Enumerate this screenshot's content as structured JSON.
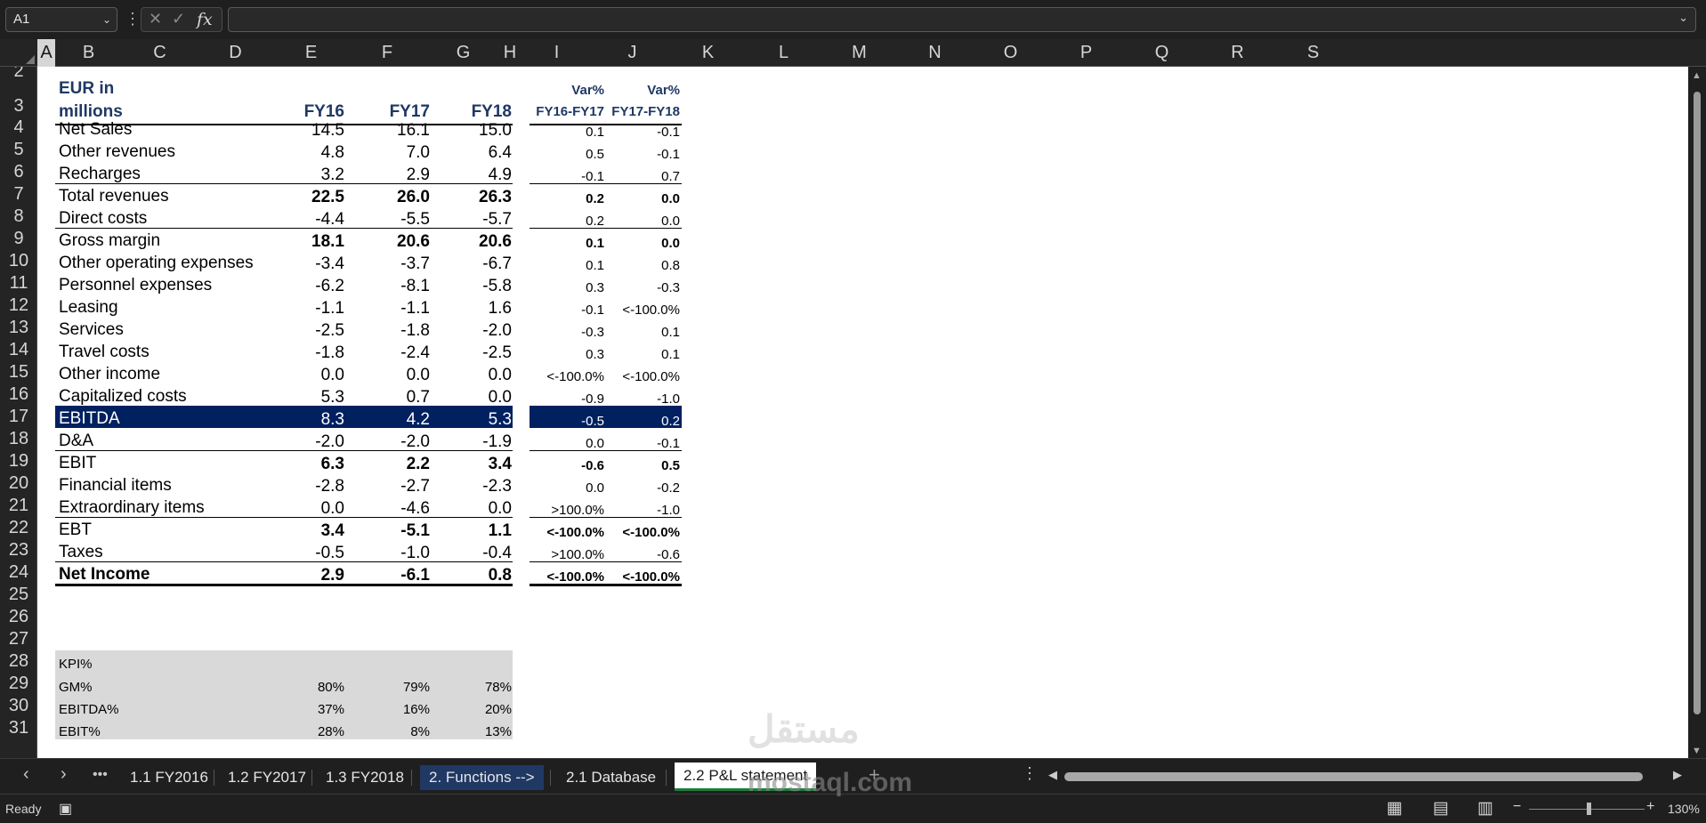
{
  "formula_bar": {
    "name_box": "A1",
    "formula": ""
  },
  "columns": [
    "A",
    "B",
    "C",
    "D",
    "E",
    "F",
    "G",
    "H",
    "I",
    "J",
    "K",
    "L",
    "M",
    "N",
    "O",
    "P",
    "Q",
    "R",
    "S"
  ],
  "rows": [
    "2",
    "3",
    "4",
    "5",
    "6",
    "7",
    "8",
    "9",
    "10",
    "11",
    "12",
    "13",
    "14",
    "15",
    "16",
    "17",
    "18",
    "19",
    "20",
    "21",
    "22",
    "23",
    "24",
    "25",
    "26",
    "27",
    "28",
    "29",
    "30",
    "31"
  ],
  "header": {
    "label_line1": "EUR in",
    "label_line2": "millions",
    "fy16": "FY16",
    "fy17": "FY17",
    "fy18": "FY18",
    "var1_line1": "Var%",
    "var1_line2": "FY16-FY17",
    "var2_line1": "Var%",
    "var2_line2": "FY17-FY18"
  },
  "pl": [
    {
      "label": "Net Sales",
      "fy16": "14.5",
      "fy17": "16.1",
      "fy18": "15.0",
      "var1": "0.1",
      "var2": "-0.1"
    },
    {
      "label": "Other revenues",
      "fy16": "4.8",
      "fy17": "7.0",
      "fy18": "6.4",
      "var1": "0.5",
      "var2": "-0.1"
    },
    {
      "label": "Recharges",
      "fy16": "3.2",
      "fy17": "2.9",
      "fy18": "4.9",
      "var1": "-0.1",
      "var2": "0.7"
    },
    {
      "label": "Total revenues",
      "fy16": "22.5",
      "fy17": "26.0",
      "fy18": "26.3",
      "var1": "0.2",
      "var2": "0.0"
    },
    {
      "label": "Direct costs",
      "fy16": "-4.4",
      "fy17": "-5.5",
      "fy18": "-5.7",
      "var1": "0.2",
      "var2": "0.0"
    },
    {
      "label": "Gross margin",
      "fy16": "18.1",
      "fy17": "20.6",
      "fy18": "20.6",
      "var1": "0.1",
      "var2": "0.0"
    },
    {
      "label": "Other operating expenses",
      "fy16": "-3.4",
      "fy17": "-3.7",
      "fy18": "-6.7",
      "var1": "0.1",
      "var2": "0.8"
    },
    {
      "label": "Personnel expenses",
      "fy16": "-6.2",
      "fy17": "-8.1",
      "fy18": "-5.8",
      "var1": "0.3",
      "var2": "-0.3"
    },
    {
      "label": "Leasing",
      "fy16": "-1.1",
      "fy17": "-1.1",
      "fy18": "1.6",
      "var1": "-0.1",
      "var2": "<-100.0%"
    },
    {
      "label": "Services",
      "fy16": "-2.5",
      "fy17": "-1.8",
      "fy18": "-2.0",
      "var1": "-0.3",
      "var2": "0.1"
    },
    {
      "label": "Travel costs",
      "fy16": "-1.8",
      "fy17": "-2.4",
      "fy18": "-2.5",
      "var1": "0.3",
      "var2": "0.1"
    },
    {
      "label": "Other income",
      "fy16": "0.0",
      "fy17": "0.0",
      "fy18": "0.0",
      "var1": "<-100.0%",
      "var2": "<-100.0%"
    },
    {
      "label": "Capitalized costs",
      "fy16": "5.3",
      "fy17": "0.7",
      "fy18": "0.0",
      "var1": "-0.9",
      "var2": "-1.0"
    },
    {
      "label": "EBITDA",
      "fy16": "8.3",
      "fy17": "4.2",
      "fy18": "5.3",
      "var1": "-0.5",
      "var2": "0.2"
    },
    {
      "label": "D&A",
      "fy16": "-2.0",
      "fy17": "-2.0",
      "fy18": "-1.9",
      "var1": "0.0",
      "var2": "-0.1"
    },
    {
      "label": "EBIT",
      "fy16": "6.3",
      "fy17": "2.2",
      "fy18": "3.4",
      "var1": "-0.6",
      "var2": "0.5"
    },
    {
      "label": "Financial items",
      "fy16": "-2.8",
      "fy17": "-2.7",
      "fy18": "-2.3",
      "var1": "0.0",
      "var2": "-0.2"
    },
    {
      "label": "Extraordinary items",
      "fy16": "0.0",
      "fy17": "-4.6",
      "fy18": "0.0",
      "var1": ">100.0%",
      "var2": "-1.0"
    },
    {
      "label": "EBT",
      "fy16": "3.4",
      "fy17": "-5.1",
      "fy18": "1.1",
      "var1": "<-100.0%",
      "var2": "<-100.0%"
    },
    {
      "label": "Taxes",
      "fy16": "-0.5",
      "fy17": "-1.0",
      "fy18": "-0.4",
      "var1": ">100.0%",
      "var2": "-0.6"
    },
    {
      "label": "Net Income",
      "fy16": "2.9",
      "fy17": "-6.1",
      "fy18": "0.8",
      "var1": "<-100.0%",
      "var2": "<-100.0%"
    }
  ],
  "kpi": {
    "title": "KPI%",
    "rows": [
      {
        "label": "GM%",
        "fy16": "80%",
        "fy17": "79%",
        "fy18": "78%"
      },
      {
        "label": "EBITDA%",
        "fy16": "37%",
        "fy17": "16%",
        "fy18": "20%"
      },
      {
        "label": "EBIT%",
        "fy16": "28%",
        "fy17": "8%",
        "fy18": "13%"
      }
    ]
  },
  "tabs": [
    "1.1 FY2016",
    "1.2 FY2017",
    "1.3 FY2018",
    "2. Functions -->",
    "2.1 Database",
    "2.2 P&L statement"
  ],
  "status": {
    "mode": "Ready",
    "zoom": "130%"
  },
  "watermark": {
    "arabic": "مستقل",
    "latin": "mostaql.com"
  },
  "colors": {
    "accent_navy": "#002060",
    "header_text": "#1f3864",
    "tab_dark": "#203864",
    "kpi_fill": "#d9d9d9",
    "sheet_bg": "#ffffff",
    "chrome_bg": "#1f1f1f"
  }
}
